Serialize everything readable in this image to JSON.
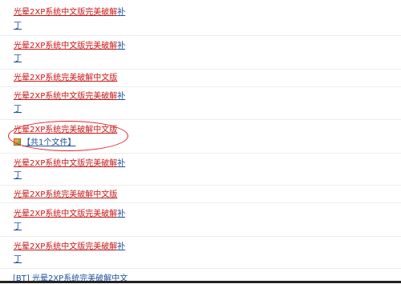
{
  "results": [
    {
      "title_red": "光晕2XP系统中文版完美破解",
      "title_blue": "补",
      "line2": "丁"
    },
    {
      "title_red": "光晕2XP系统中文版完美破解",
      "title_blue": "补",
      "line2": "丁"
    },
    {
      "title_red": "光晕2XP系统完美破解中文版",
      "title_blue": "",
      "line2": ""
    },
    {
      "title_red": "光晕2XP系统中文版完美破解",
      "title_blue": "补",
      "line2": "丁"
    },
    {
      "title_red": "光晕2XP系统完美破解中文版",
      "title_blue": "",
      "line2": "",
      "files_label": "【共1个文件】"
    },
    {
      "title_red": "光晕2XP系统中文版完美破解",
      "title_blue": "补",
      "line2": "丁"
    },
    {
      "title_red": "光晕2XP系统完美破解中文版",
      "title_blue": "",
      "line2": ""
    },
    {
      "title_red": "光晕2XP系统中文版完美破解",
      "title_blue": "补",
      "line2": "丁"
    },
    {
      "title_red": "光晕2XP系统中文版完美破解",
      "title_blue": "补",
      "line2": "丁"
    },
    {
      "title_red": "[BT] 光晕2XP系统完美破解中文",
      "title_blue": "",
      "line2": ""
    }
  ],
  "colors": {
    "title": "#c81414",
    "link": "#1f4f9c",
    "annotation": "#e02020"
  }
}
